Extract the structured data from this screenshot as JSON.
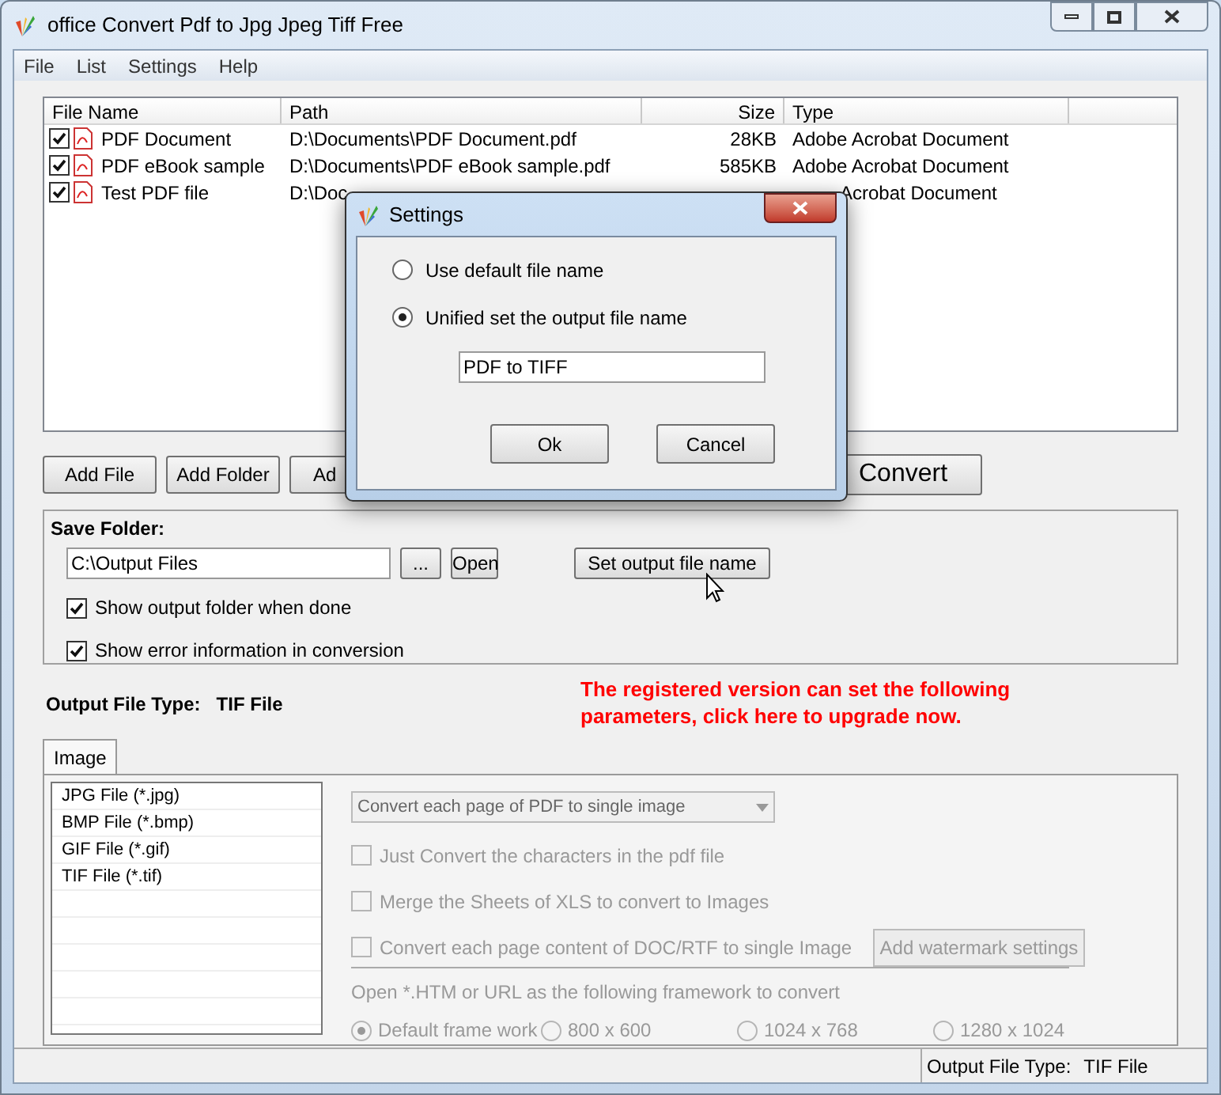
{
  "window": {
    "title": "office Convert Pdf to Jpg Jpeg Tiff Free"
  },
  "menu": [
    "File",
    "List",
    "Settings",
    "Help"
  ],
  "file_list": {
    "columns": [
      "File Name",
      "Path",
      "Size",
      "Type"
    ],
    "rows": [
      {
        "checked": true,
        "name": "PDF Document",
        "path": "D:\\Documents\\PDF Document.pdf",
        "size": "28KB",
        "type": "Adobe Acrobat Document"
      },
      {
        "checked": true,
        "name": "PDF eBook sample",
        "path": "D:\\Documents\\PDF eBook sample.pdf",
        "size": "585KB",
        "type": "Adobe Acrobat Document"
      },
      {
        "checked": true,
        "name": "Test PDF file",
        "path": "D:\\Doc",
        "type": "Acrobat Document"
      }
    ]
  },
  "list_buttons": [
    "Add File",
    "Add Folder",
    "Ad"
  ],
  "convert_button": "Convert",
  "save_folder": {
    "label": "Save Folder:",
    "path": "C:\\Output Files",
    "browse": "...",
    "open": "Open",
    "set_name": "Set output file name",
    "options": [
      {
        "label": "Show output folder when done",
        "checked": true
      },
      {
        "label": "Show error information in conversion",
        "checked": true
      }
    ]
  },
  "output_type": {
    "label": "Output File Type:",
    "value": "TIF File"
  },
  "upgrade_notice": "The registered version can set the following parameters, click here to upgrade now.",
  "tabs": [
    {
      "label": "Image",
      "selected": true
    }
  ],
  "formats": [
    {
      "label": "JPG File  (*.jpg)",
      "selected": false
    },
    {
      "label": "BMP File  (*.bmp)",
      "selected": false
    },
    {
      "label": "GIF File  (*.gif)",
      "selected": false
    },
    {
      "label": "TIF File  (*.tif)",
      "selected": false
    }
  ],
  "mode_select": {
    "value": "Convert each page of PDF to single image",
    "disabled": true
  },
  "image_options": [
    {
      "label": "Just Convert the characters in the pdf file",
      "checked": false
    },
    {
      "label": "Merge the Sheets of XLS to convert to Images",
      "checked": false
    },
    {
      "label": "Convert each page content of DOC/RTF to single Image",
      "checked": false
    }
  ],
  "watermark_button": "Add watermark settings",
  "framework": {
    "label": "Open *.HTM or URL as the following framework to convert",
    "options": [
      {
        "label": "Default frame work",
        "selected": true
      },
      {
        "label": "800 x 600",
        "selected": false
      },
      {
        "label": "1024 x 768",
        "selected": false
      },
      {
        "label": "1280 x 1024",
        "selected": false
      }
    ]
  },
  "status_bar": {
    "label": "Output File Type:",
    "value": "TIF File"
  },
  "dialog": {
    "title": "Settings",
    "options": [
      {
        "label": "Use default file name",
        "selected": false
      },
      {
        "label": "Unified set the output file name",
        "selected": true
      }
    ],
    "file_name": "PDF to TIFF",
    "buttons": [
      "Ok",
      "Cancel"
    ]
  }
}
